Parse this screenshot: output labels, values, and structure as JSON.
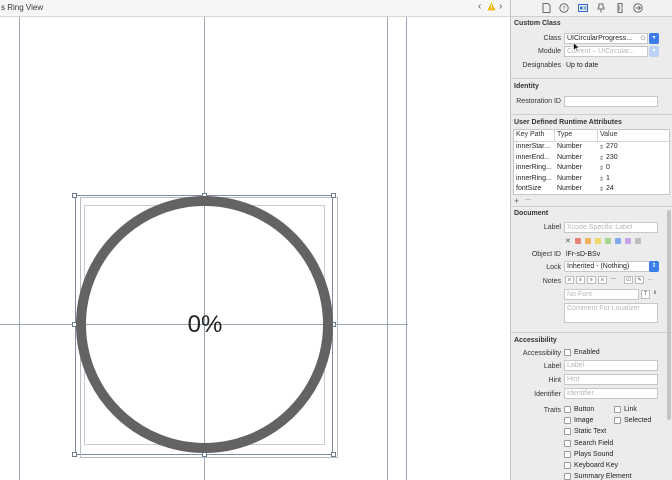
{
  "canvas": {
    "title": "s Ring View",
    "percent_label": "0%",
    "nav_back": "‹",
    "nav_forward": "›",
    "warning_icon": "warning-icon"
  },
  "inspector": {
    "tabs": [
      "file-icon",
      "help-icon",
      "identity-icon",
      "attributes-icon",
      "size-icon",
      "connections-icon"
    ],
    "custom_class": {
      "title": "Custom Class",
      "class_label": "Class",
      "class_value": "UICircularProgress...",
      "module_label": "Module",
      "module_placeholder": "Current – UICircular...",
      "designables_label": "Designables",
      "designables_value": "Up to date"
    },
    "identity": {
      "title": "Identity",
      "restoration_label": "Restoration ID"
    },
    "runtime": {
      "title": "User Defined Runtime Attributes",
      "headers": [
        "Key Path",
        "Type",
        "Value"
      ],
      "rows": [
        {
          "key": "innerStar...",
          "type": "Number",
          "value": "270"
        },
        {
          "key": "innerEnd...",
          "type": "Number",
          "value": "230"
        },
        {
          "key": "innerRing...",
          "type": "Number",
          "value": "0"
        },
        {
          "key": "innerRing...",
          "type": "Number",
          "value": "1"
        },
        {
          "key": "fontSize",
          "type": "Number",
          "value": "24"
        }
      ],
      "add_button": "+",
      "remove_button": "—"
    },
    "document": {
      "title": "Document",
      "label_label": "Label",
      "label_placeholder": "Xcode Specific Label",
      "clear_color": "✕",
      "swatch_colors": [
        "#e8837a",
        "#f2b15c",
        "#eed86a",
        "#a6d58c",
        "#7ea9ef",
        "#c6a6e6",
        "#bdbdbd"
      ],
      "object_id_label": "Object ID",
      "object_id_value": "lFr-sD-BSv",
      "lock_label": "Lock",
      "lock_value": "Inherited - (Nothing)",
      "notes_label": "Notes",
      "font_placeholder": "No Font",
      "comment_placeholder": "Comment For Localizer"
    },
    "accessibility": {
      "title": "Accessibility",
      "accessibility_label": "Accessibility",
      "enabled_label": "Enabled",
      "label_label": "Label",
      "label_placeholder": "Label",
      "hint_label": "Hint",
      "hint_placeholder": "Hint",
      "identifier_label": "Identifier",
      "identifier_placeholder": "Identifier",
      "traits_label": "Traits",
      "traits_col1": [
        "Button",
        "Image",
        "Static Text",
        "Search Field",
        "Plays Sound",
        "Keyboard Key",
        "Summary Element"
      ],
      "traits_col2": [
        "Link",
        "Selected"
      ]
    }
  }
}
